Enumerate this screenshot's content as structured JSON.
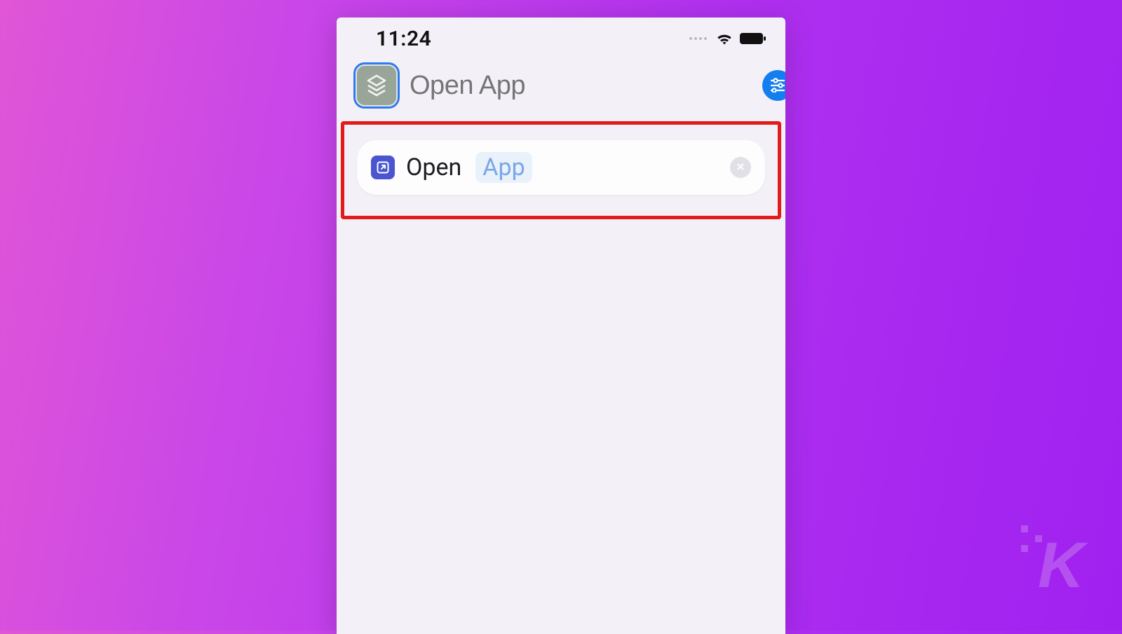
{
  "status": {
    "time": "11:24"
  },
  "header": {
    "title_placeholder": "Open App"
  },
  "action": {
    "verb": "Open",
    "param": "App"
  },
  "watermark": {
    "letter": "K"
  }
}
